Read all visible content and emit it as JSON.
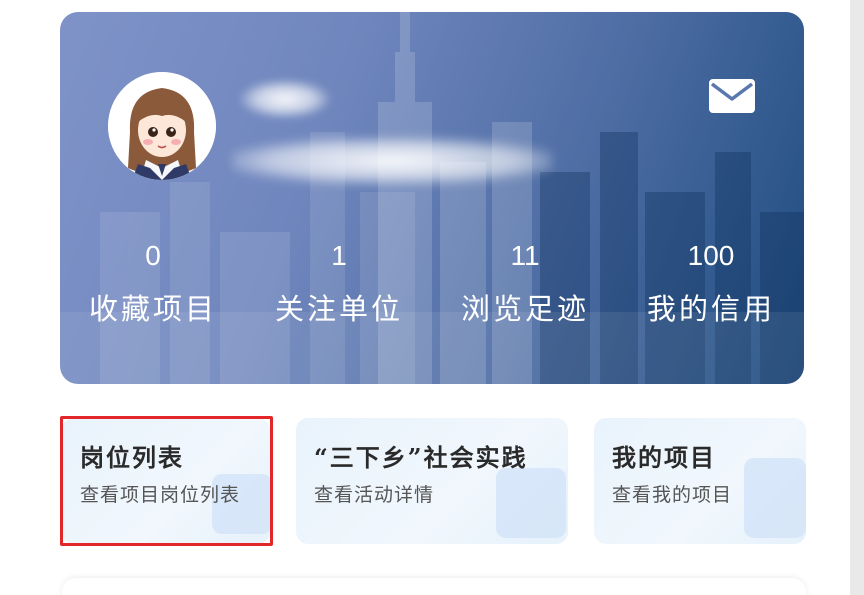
{
  "icons": {
    "mail": "mail-icon",
    "avatar": "avatar-illustration"
  },
  "colors": {
    "card_gradient_start": "#7f93c8",
    "card_gradient_end": "#1f4d80",
    "highlight": "#e3262a",
    "tile_background": "#e9f3fc"
  },
  "profile": {
    "name": "",
    "id": ""
  },
  "stats": [
    {
      "value": "0",
      "label": "收藏项目"
    },
    {
      "value": "1",
      "label": "关注单位"
    },
    {
      "value": "11",
      "label": "浏览足迹"
    },
    {
      "value": "100",
      "label": "我的信用"
    }
  ],
  "tiles": [
    {
      "title": "岗位列表",
      "subtitle": "查看项目岗位列表"
    },
    {
      "title": "“三下乡”社会实践",
      "subtitle": "查看活动详情"
    },
    {
      "title": "我的项目",
      "subtitle": "查看我的项目"
    }
  ]
}
